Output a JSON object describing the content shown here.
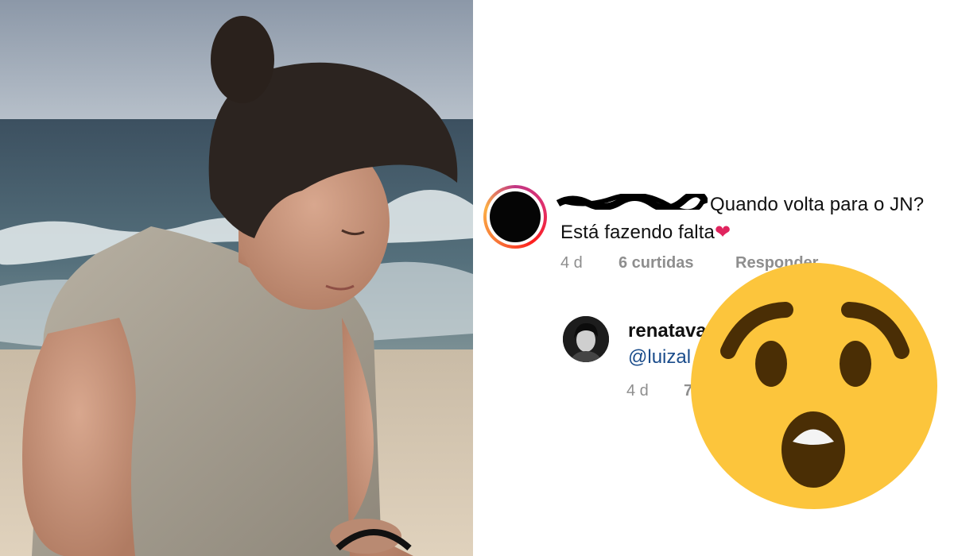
{
  "photo": {
    "description_icon": "woman-on-beach-photo"
  },
  "comment": {
    "text_line1": "Quando volta para o JN?",
    "text_line2": "Está fazendo falta",
    "heart": "❤",
    "time": "4 d",
    "likes": "6 curtidas",
    "reply_action": "Responder"
  },
  "reply": {
    "username": "renatava",
    "mention": "@luizal",
    "time": "4 d",
    "likes_partial": "7"
  },
  "colors": {
    "heart": "#e0245e",
    "mention": "#1a4c8b",
    "emoji_face": "#fcc53c",
    "emoji_features": "#4a2e05"
  },
  "emoji": {
    "icon": "astonished-face-icon"
  }
}
